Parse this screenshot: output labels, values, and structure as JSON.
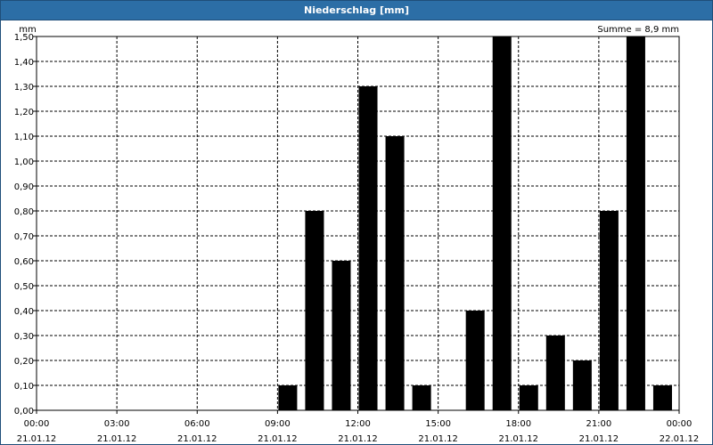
{
  "title": "Niederschlag [mm]",
  "colors": {
    "titlebar": "#2c6ea6",
    "bars": "#000000",
    "grid": "#000000",
    "background": "#ffffff"
  },
  "chart_data": {
    "type": "bar",
    "title": "Niederschlag [mm]",
    "ylabel": "mm",
    "ylim": [
      0,
      1.5
    ],
    "yticks": [
      "0,00",
      "0,10",
      "0,20",
      "0,30",
      "0,40",
      "0,50",
      "0,60",
      "0,70",
      "0,80",
      "0,90",
      "1,00",
      "1,10",
      "1,20",
      "1,30",
      "1,40",
      "1,50"
    ],
    "xlim_hours": [
      0,
      24
    ],
    "xticks": [
      {
        "time": "00:00",
        "date": "21.01.12"
      },
      {
        "time": "03:00",
        "date": "21.01.12"
      },
      {
        "time": "06:00",
        "date": "21.01.12"
      },
      {
        "time": "09:00",
        "date": "21.01.12"
      },
      {
        "time": "12:00",
        "date": "21.01.12"
      },
      {
        "time": "15:00",
        "date": "21.01.12"
      },
      {
        "time": "18:00",
        "date": "21.01.12"
      },
      {
        "time": "21:00",
        "date": "21.01.12"
      },
      {
        "time": "00:00",
        "date": "22.01.12"
      }
    ],
    "bar_interval_hours": 1,
    "bars": [
      {
        "hour": 9,
        "value": 0.1
      },
      {
        "hour": 10,
        "value": 0.8
      },
      {
        "hour": 11,
        "value": 0.6
      },
      {
        "hour": 12,
        "value": 1.3
      },
      {
        "hour": 13,
        "value": 1.1
      },
      {
        "hour": 14,
        "value": 0.1
      },
      {
        "hour": 16,
        "value": 0.4
      },
      {
        "hour": 17,
        "value": 1.5
      },
      {
        "hour": 18,
        "value": 0.1
      },
      {
        "hour": 19,
        "value": 0.3
      },
      {
        "hour": 20,
        "value": 0.2
      },
      {
        "hour": 21,
        "value": 0.8
      },
      {
        "hour": 22,
        "value": 1.5
      },
      {
        "hour": 23,
        "value": 0.1
      }
    ],
    "annotation": "Summe = 8,9 mm",
    "grid": true,
    "grid_style": "dashed"
  }
}
